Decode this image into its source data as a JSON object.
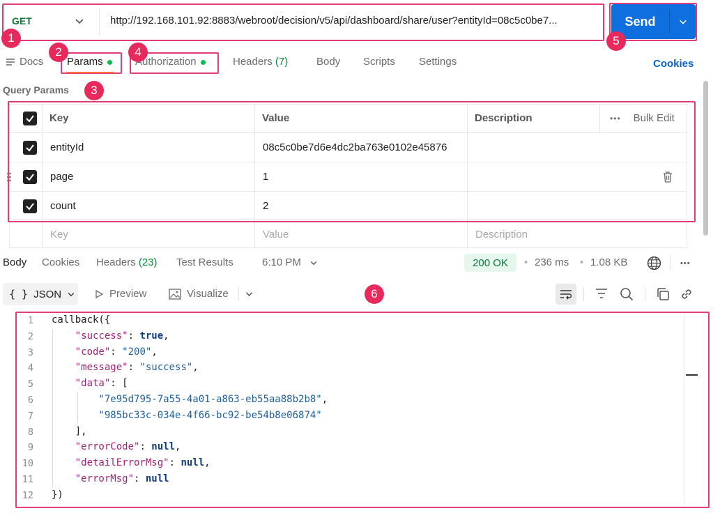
{
  "request": {
    "method": "GET",
    "url": "http://192.168.101.92:8883/webroot/decision/v5/api/dashboard/share/user?entityId=08c5c0be7...",
    "send_label": "Send"
  },
  "request_tabs": [
    {
      "label": "Docs"
    },
    {
      "label": "Params"
    },
    {
      "label": "Authorization"
    },
    {
      "label": "Headers",
      "count": "(7)"
    },
    {
      "label": "Body"
    },
    {
      "label": "Scripts"
    },
    {
      "label": "Settings"
    }
  ],
  "cookies_label": "Cookies",
  "query_params": {
    "title": "Query Params",
    "headers": {
      "key": "Key",
      "value": "Value",
      "description": "Description",
      "bulk_edit": "Bulk Edit"
    },
    "rows": [
      {
        "key": "entityId",
        "value": "08c5c0be7d6e4dc2ba763e0102e45876",
        "description": ""
      },
      {
        "key": "page",
        "value": "1",
        "description": ""
      },
      {
        "key": "count",
        "value": "2",
        "description": ""
      }
    ],
    "placeholders": {
      "key": "Key",
      "value": "Value",
      "description": "Description"
    }
  },
  "response": {
    "tabs": [
      {
        "label": "Body"
      },
      {
        "label": "Cookies"
      },
      {
        "label": "Headers",
        "count": "(23)"
      },
      {
        "label": "Test Results"
      }
    ],
    "time_label": "6:10 PM",
    "status": "200 OK",
    "duration": "236 ms",
    "size": "1.08 KB",
    "format": "JSON",
    "preview_label": "Preview",
    "visualize_label": "Visualize"
  },
  "markers": [
    "1",
    "2",
    "3",
    "4",
    "5",
    "6"
  ],
  "code_line_numbers": [
    "1",
    "2",
    "3",
    "4",
    "5",
    "6",
    "7",
    "8",
    "9",
    "10",
    "11",
    "12"
  ],
  "code": {
    "l1": "callback({",
    "success_key": "\"success\"",
    "success_val": "true",
    "code_key": "\"code\"",
    "code_val": "\"200\"",
    "message_key": "\"message\"",
    "message_val": "\"success\"",
    "data_key": "\"data\"",
    "data_open": "[",
    "data_1": "\"7e95d795-7a55-4a01-a863-eb55aa88b2b8\"",
    "data_2": "\"985bc33c-034e-4f66-bc92-be54b8e06874\"",
    "data_close": "],",
    "errorCode_key": "\"errorCode\"",
    "detailErrorMsg_key": "\"detailErrorMsg\"",
    "errorMsg_key": "\"errorMsg\"",
    "null_val": "null",
    "l12": "})"
  },
  "colors": {
    "highlight": "#e03c78",
    "marker": "#e8295b",
    "send": "#0f6fde",
    "method": "#0d7a35",
    "status_ok": "#0a7a38"
  }
}
